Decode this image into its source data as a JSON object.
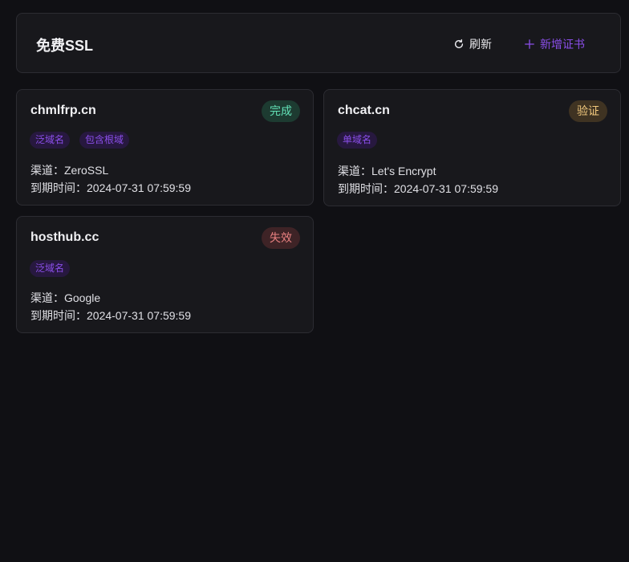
{
  "header": {
    "title": "免费SSL",
    "refresh_label": "刷新",
    "add_label": "新增证书"
  },
  "certs": [
    {
      "domain": "chmlfrp.cn",
      "status": "完成",
      "tags": [
        "泛域名",
        "包含根域"
      ],
      "channel": "渠道：ZeroSSL",
      "expiry": "到期时间：2024-07-31 07:59:59"
    },
    {
      "domain": "chcat.cn",
      "status": "验证",
      "tags": [
        "单域名"
      ],
      "channel": "渠道：Let's Encrypt",
      "expiry": "到期时间：2024-07-31 07:59:59"
    },
    {
      "domain": "hosthub.cc",
      "status": "失效",
      "tags": [
        "泛域名"
      ],
      "channel": "渠道：Google",
      "expiry": "到期时间：2024-07-31 07:59:59"
    }
  ],
  "colors": {
    "accent": "#8a4ee8",
    "success": "#63e2b7",
    "warning": "#f2c97d",
    "error": "#e88080"
  },
  "icons": {
    "refresh": "refresh-icon",
    "add": "plus-icon"
  }
}
